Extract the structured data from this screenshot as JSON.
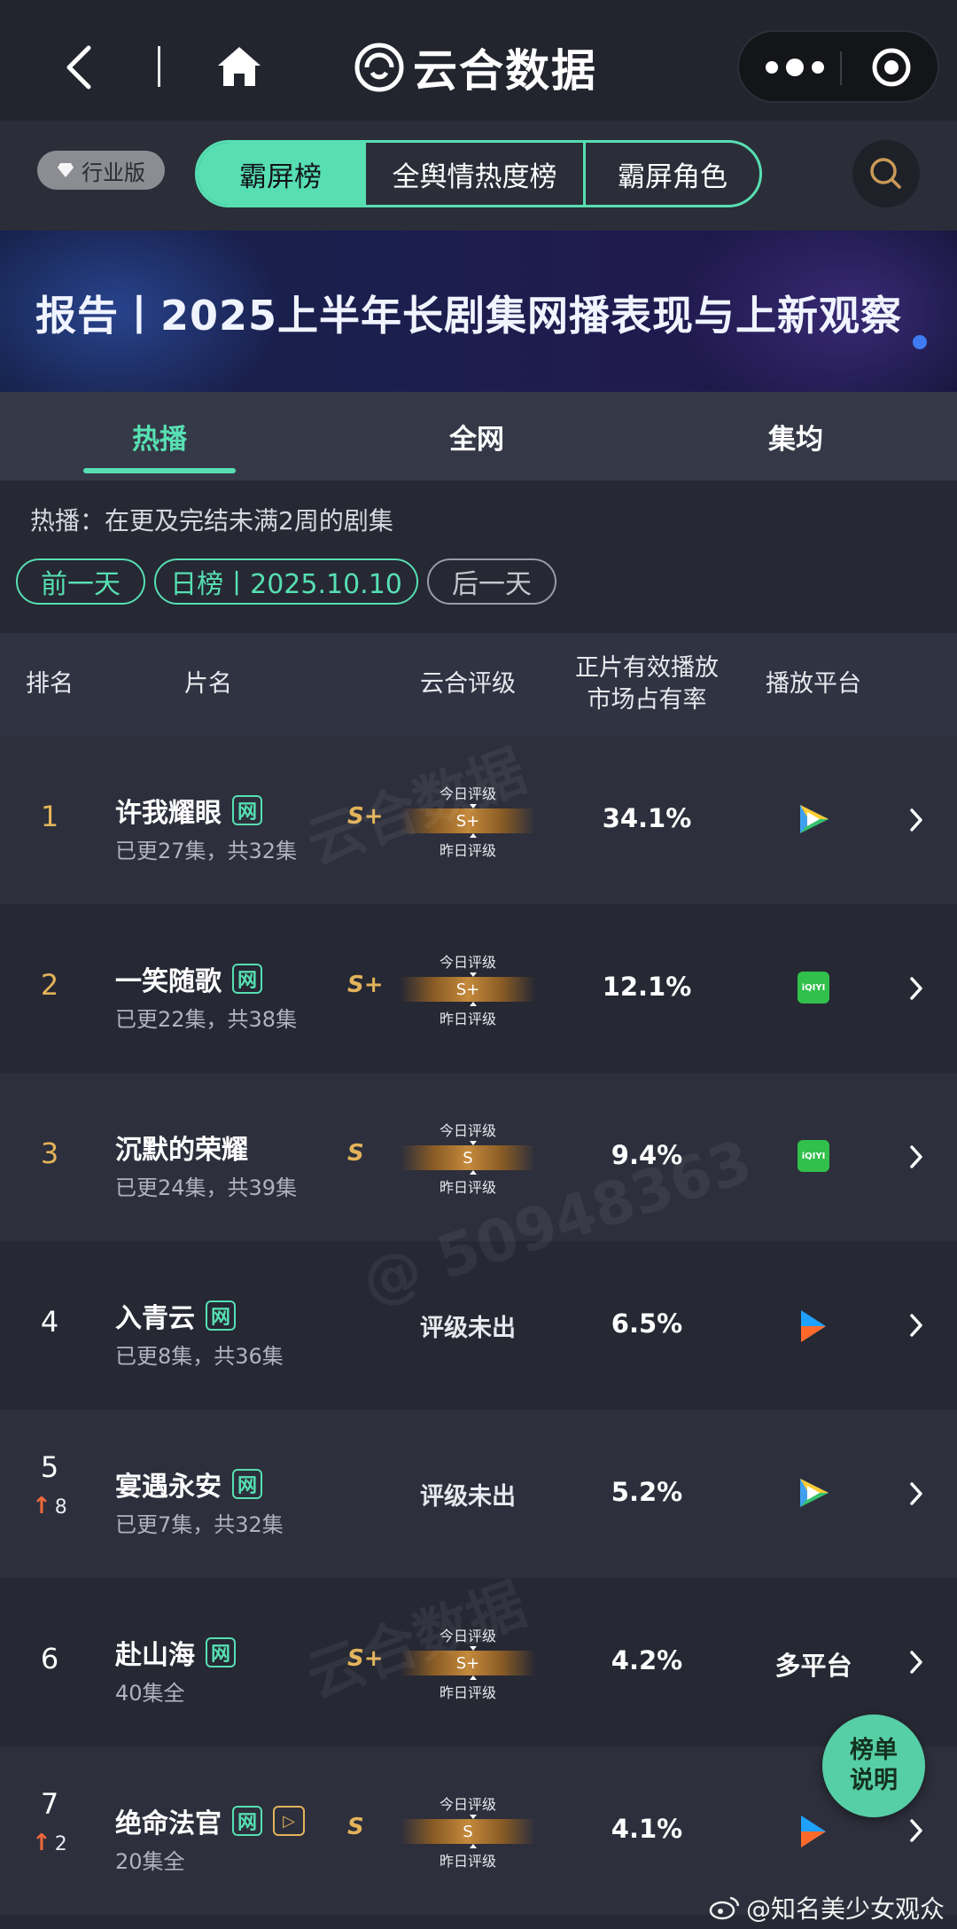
{
  "app": {
    "brand": "云合数据"
  },
  "filter": {
    "industry_label": "行业版",
    "segments": [
      "霸屏榜",
      "全舆情热度榜",
      "霸屏角色"
    ]
  },
  "banner": {
    "text": "报告丨2025上半年长剧集网播表现与上新观察"
  },
  "tabs": [
    "热播",
    "全网",
    "集均"
  ],
  "description": "热播：在更及完结未满2周的剧集",
  "date_nav": {
    "prev": "前一天",
    "current": "日榜丨2025.10.10",
    "next": "后一天"
  },
  "table_headers": {
    "rank": "排名",
    "name": "片名",
    "grade": "云合评级",
    "share_line1": "正片有效播放",
    "share_line2": "市场占有率",
    "platform": "播放平台"
  },
  "grade_labels": {
    "today": "今日评级",
    "yesterday": "昨日评级",
    "none": "评级未出"
  },
  "rows": [
    {
      "rank": "1",
      "change": "",
      "title": "许我耀眼",
      "tag": "网",
      "vip": "",
      "episodes": "已更27集，共32集",
      "grade_big": "S+",
      "grade_today": "S+",
      "share": "34.1%",
      "platform": "tencent-video-icon",
      "platform_text": ""
    },
    {
      "rank": "2",
      "change": "",
      "title": "一笑随歌",
      "tag": "网",
      "vip": "",
      "episodes": "已更22集，共38集",
      "grade_big": "S+",
      "grade_today": "S+",
      "share": "12.1%",
      "platform": "iqiyi-icon",
      "platform_text": ""
    },
    {
      "rank": "3",
      "change": "",
      "title": "沉默的荣耀",
      "tag": "",
      "vip": "",
      "episodes": "已更24集，共39集",
      "grade_big": "S",
      "grade_today": "S",
      "share": "9.4%",
      "platform": "iqiyi-icon",
      "platform_text": ""
    },
    {
      "rank": "4",
      "change": "",
      "title": "入青云",
      "tag": "网",
      "vip": "",
      "episodes": "已更8集，共36集",
      "grade_big": "",
      "grade_today": "",
      "share": "6.5%",
      "platform": "youku-icon",
      "platform_text": ""
    },
    {
      "rank": "5",
      "change": "8",
      "title": "宴遇永安",
      "tag": "网",
      "vip": "",
      "episodes": "已更7集，共32集",
      "grade_big": "",
      "grade_today": "",
      "share": "5.2%",
      "platform": "tencent-video-icon",
      "platform_text": ""
    },
    {
      "rank": "6",
      "change": "",
      "title": "赴山海",
      "tag": "网",
      "vip": "",
      "episodes": "40集全",
      "grade_big": "S+",
      "grade_today": "S+",
      "share": "4.2%",
      "platform": "",
      "platform_text": "多平台"
    },
    {
      "rank": "7",
      "change": "2",
      "title": "绝命法官",
      "tag": "网",
      "vip": "▷",
      "episodes": "20集全",
      "grade_big": "S",
      "grade_today": "S",
      "share": "4.1%",
      "platform": "youku-icon",
      "platform_text": ""
    }
  ],
  "float_button": {
    "line1": "榜单",
    "line2": "说明"
  },
  "watermark": {
    "user": "@知名美少女观众"
  },
  "colors": {
    "accent": "#57dfb2",
    "gold": "#e3b35a",
    "background": "#262833"
  }
}
